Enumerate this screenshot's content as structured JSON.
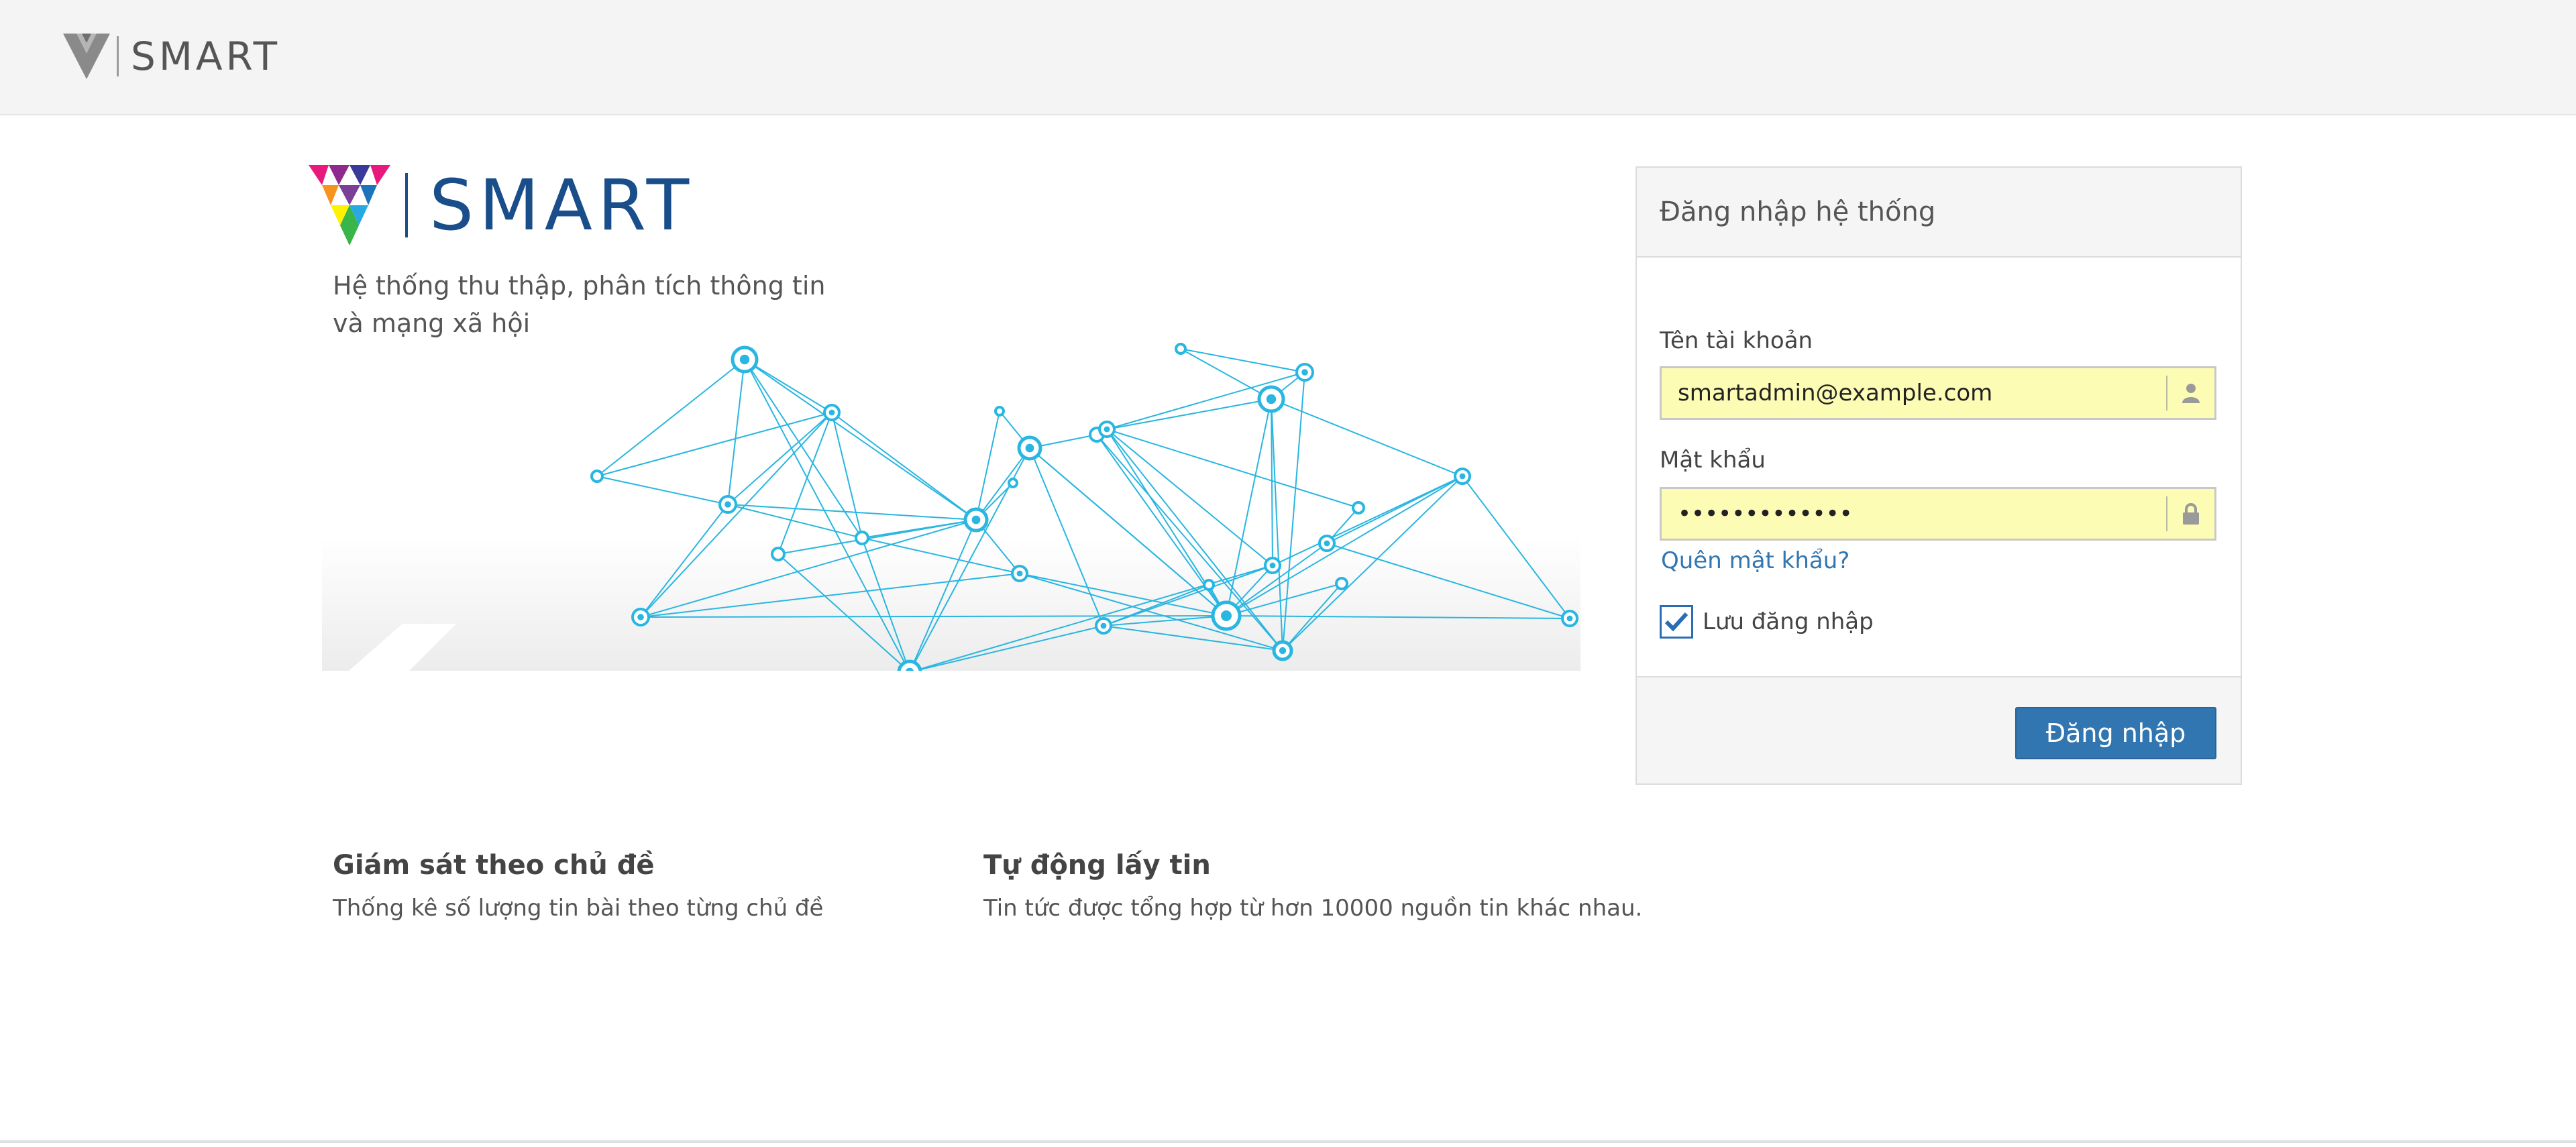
{
  "topbar": {
    "brand": "SMART",
    "logo_icon": "v-logo-icon"
  },
  "hero": {
    "brand": "SMART",
    "tagline_line1": "Hệ thống thu thập, phân tích thông tin",
    "tagline_line2": "và mạng xã hội"
  },
  "features": [
    {
      "title": "Giám sát theo chủ đề",
      "desc": "Thống kê số lượng tin bài theo từng chủ đề"
    },
    {
      "title": "Tự động lấy tin",
      "desc": "Tin tức được tổng hợp từ hơn 10000 nguồn tin khác nhau."
    }
  ],
  "login": {
    "title": "Đăng nhập hệ thống",
    "username_label": "Tên tài khoản",
    "username_value": "smartadmin@example.com",
    "password_label": "Mật khẩu",
    "password_value": "•••••••••••••",
    "forgot_link": "Quên mật khẩu?",
    "remember_label": "Lưu đăng nhập",
    "remember_checked": true,
    "submit_label": "Đăng nhập"
  },
  "colors": {
    "brand_blue": "#1a4e8a",
    "button_blue": "#3276b1",
    "input_autofill": "#fcfcb4",
    "network_cyan": "#29b6e0"
  }
}
